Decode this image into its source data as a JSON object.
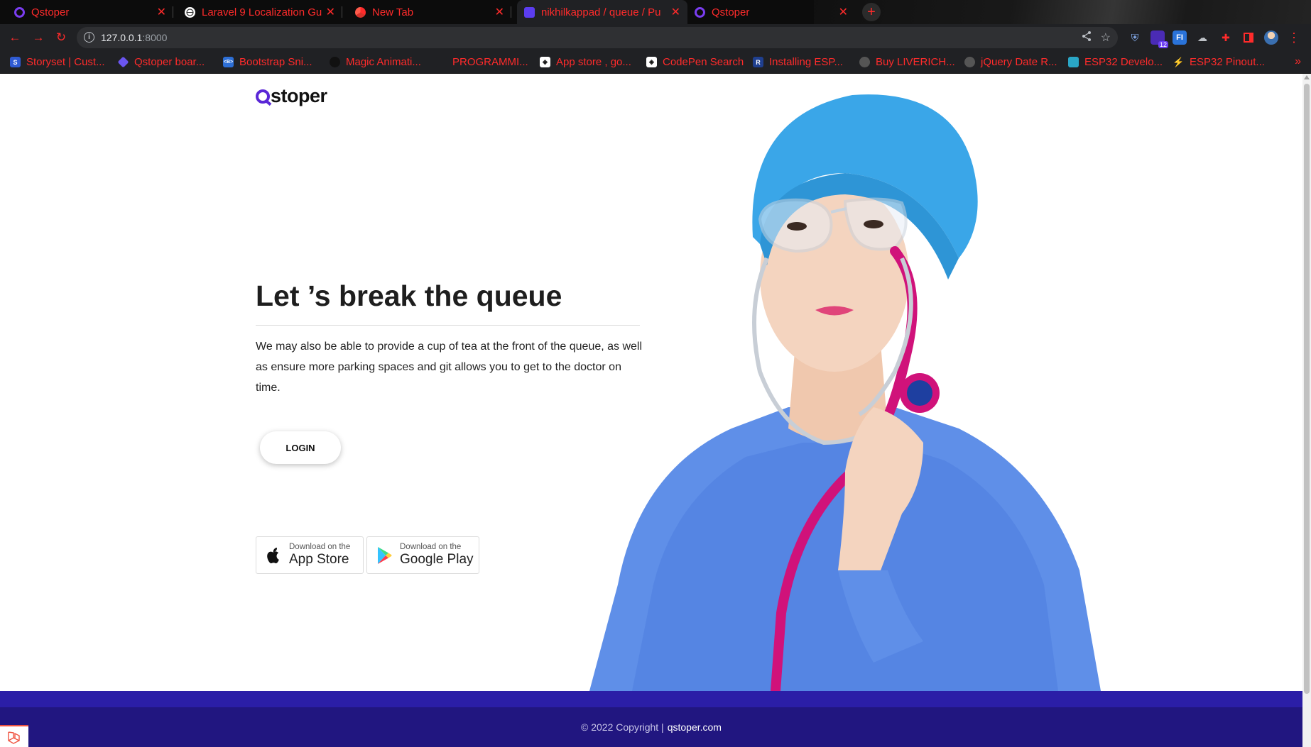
{
  "browser": {
    "tabs": [
      {
        "title": "Qstoper",
        "favicon": "qstoper-icon"
      },
      {
        "title": "Laravel 9 Localization Gu",
        "favicon": "globe-icon"
      },
      {
        "title": "New Tab",
        "favicon": "chrome-icon"
      },
      {
        "title": "nikhilkappad / queue / Pu",
        "favicon": "bitbucket-icon"
      },
      {
        "title": "Qstoper",
        "favicon": "qstoper-icon"
      }
    ],
    "new_tab_label": "+",
    "url_host": "127.0.0.1",
    "url_port": ":8000",
    "extension_badge": "12",
    "bookmarks": [
      {
        "label": "Storyset | Cust...",
        "icon": "storyset-icon"
      },
      {
        "label": "Qstoper boar...",
        "icon": "jira-icon"
      },
      {
        "label": "Bootstrap Sni...",
        "icon": "bootstrap-icon"
      },
      {
        "label": "Magic Animati...",
        "icon": "github-icon"
      },
      {
        "label": "PROGRAMMI...",
        "icon": "folder-icon"
      },
      {
        "label": "App store , go...",
        "icon": "codepen-icon"
      },
      {
        "label": "CodePen Search",
        "icon": "codepen-icon"
      },
      {
        "label": "Installing ESP...",
        "icon": "r-icon"
      },
      {
        "label": "Buy LIVERICH...",
        "icon": "globe-icon"
      },
      {
        "label": "jQuery Date R...",
        "icon": "globe-icon"
      },
      {
        "label": "ESP32 Develo...",
        "icon": "esp-icon"
      },
      {
        "label": "ESP32 Pinout...",
        "icon": "lightning-icon"
      }
    ],
    "bookmarks_more": "»"
  },
  "page": {
    "logo_text": "stoper",
    "hero_title": "Let ’s break the queue",
    "hero_text": "We may also be able to provide a cup of tea at the front of the queue, as well as ensure more parking spaces and git allows you to get to the doctor on time.",
    "login_label": "LOGIN",
    "app_store": {
      "small": "Download on the",
      "big": "App Store"
    },
    "google_play": {
      "small": "Download on the",
      "big": "Google Play"
    },
    "footer_text": "© 2022 Copyright |",
    "footer_link": "qstoper.com"
  },
  "colors": {
    "brand": "#5a27d6",
    "footer": "#211680",
    "footer_band": "#2b1ea7",
    "chrome_accent": "#ff2b2b"
  }
}
